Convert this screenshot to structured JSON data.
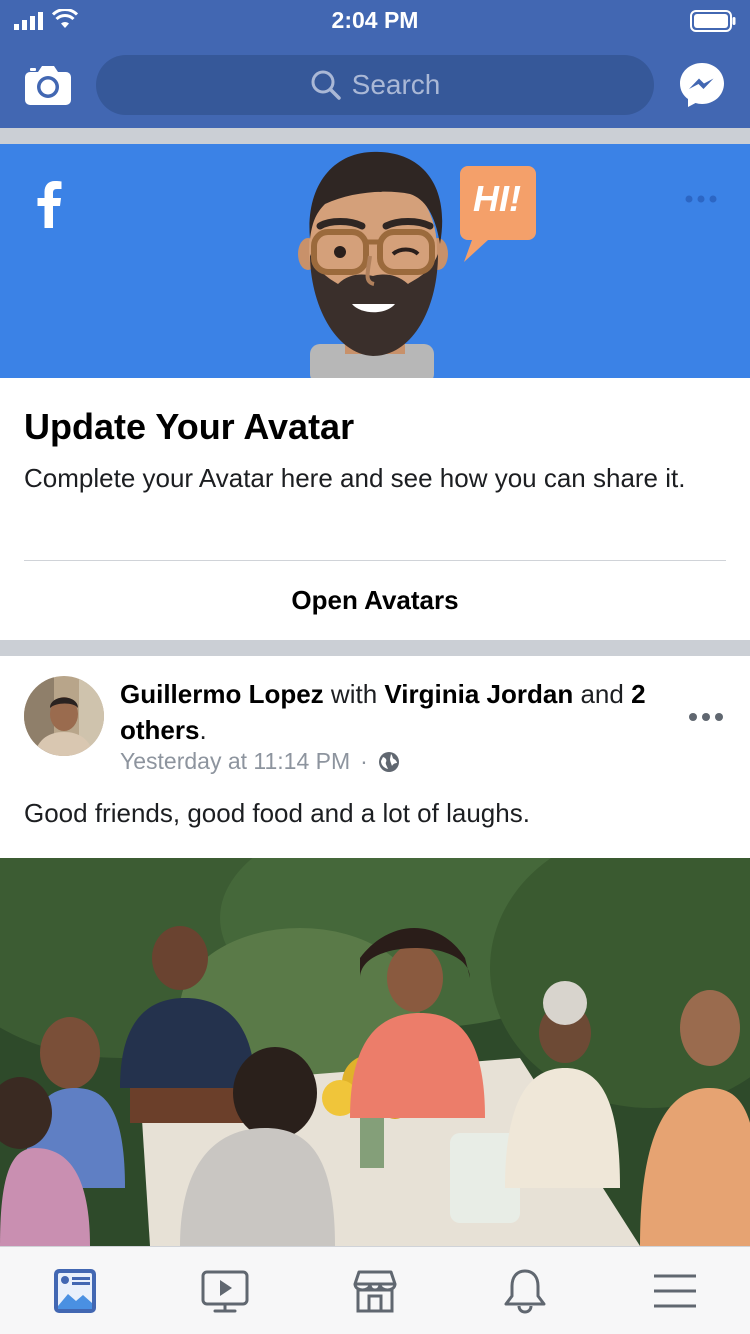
{
  "status_bar": {
    "time": "2:04 PM"
  },
  "header": {
    "search_placeholder": "Search",
    "brand_color": "#4267b2"
  },
  "avatar_promo": {
    "bubble_text": "HI!",
    "title": "Update Your Avatar",
    "description": "Complete your Avatar here and see how you can share it.",
    "action_label": "Open Avatars",
    "banner_color": "#3b82e6"
  },
  "post": {
    "author": "Guillermo Lopez",
    "with_word": "with",
    "tagged": "Virginia Jordan",
    "and_word": "and",
    "others": "2 others",
    "period": ".",
    "timestamp": "Yesterday at 11:14 PM",
    "separator": "·",
    "privacy_icon": "globe-icon",
    "text": "Good friends, good food and a lot of laughs."
  },
  "tab_bar": {
    "tabs": [
      {
        "icon": "news-feed-icon",
        "active": true
      },
      {
        "icon": "watch-icon",
        "active": false
      },
      {
        "icon": "marketplace-icon",
        "active": false
      },
      {
        "icon": "notifications-bell-icon",
        "active": false
      },
      {
        "icon": "menu-icon",
        "active": false
      }
    ],
    "active_color": "#4267b2"
  }
}
